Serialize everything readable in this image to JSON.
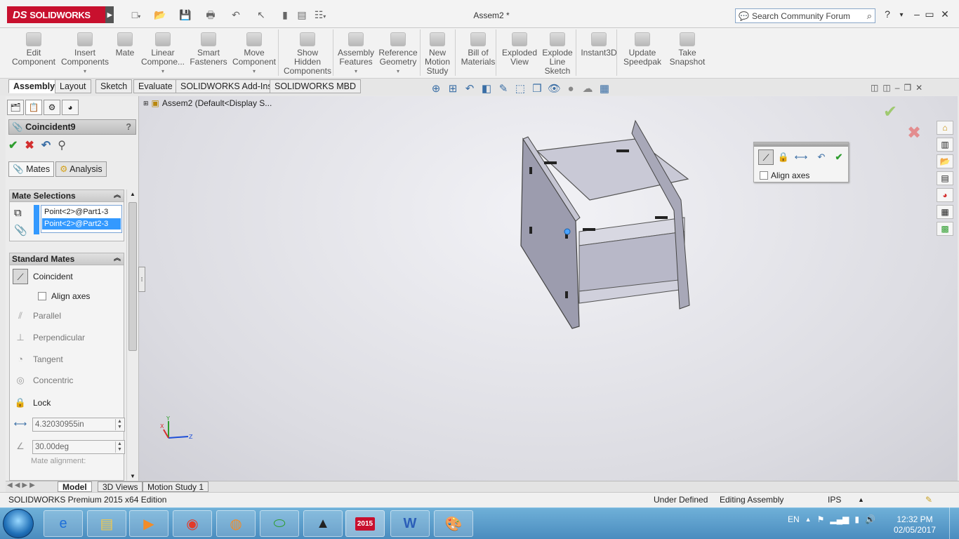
{
  "app": {
    "brand": "SOLIDWORKS",
    "doc_title": "Assem2 *",
    "search_placeholder": "Search Community Forum"
  },
  "ribbon": [
    {
      "label": "Edit\nComponent"
    },
    {
      "label": "Insert\nComponents"
    },
    {
      "label": "Mate"
    },
    {
      "label": "Linear\nCompone..."
    },
    {
      "label": "Smart\nFasteners"
    },
    {
      "label": "Move\nComponent"
    },
    {
      "label": "Show\nHidden\nComponents"
    },
    {
      "label": "Assembly\nFeatures"
    },
    {
      "label": "Reference\nGeometry"
    },
    {
      "label": "New\nMotion\nStudy"
    },
    {
      "label": "Bill of\nMaterials"
    },
    {
      "label": "Exploded\nView"
    },
    {
      "label": "Explode\nLine\nSketch"
    },
    {
      "label": "Instant3D"
    },
    {
      "label": "Update\nSpeedpak"
    },
    {
      "label": "Take\nSnapshot"
    }
  ],
  "command_tabs": [
    "Assembly",
    "Layout",
    "Sketch",
    "Evaluate",
    "SOLIDWORKS Add-Ins",
    "SOLIDWORKS MBD"
  ],
  "property_manager": {
    "title": "Coincident9",
    "help": "?",
    "tabs": [
      "Mates",
      "Analysis"
    ],
    "mate_selections": {
      "header": "Mate Selections",
      "items": [
        "Point<2>@Part1-3",
        "Point<2>@Part2-3"
      ]
    },
    "standard_mates": {
      "header": "Standard Mates",
      "coincident": "Coincident",
      "align_axes": "Align axes",
      "parallel": "Parallel",
      "perpendicular": "Perpendicular",
      "tangent": "Tangent",
      "concentric": "Concentric",
      "lock": "Lock",
      "distance": "4.32030955in",
      "angle": "30.00deg",
      "mate_alignment": "Mate alignment:"
    }
  },
  "feature_tree": {
    "root": "Assem2  (Default<Display S..."
  },
  "float_panel": {
    "align_axes": "Align axes"
  },
  "bottom_tabs": [
    "Model",
    "3D Views",
    "Motion Study 1"
  ],
  "status": {
    "edition": "SOLIDWORKS Premium 2015 x64 Edition",
    "state": "Under Defined",
    "mode": "Editing Assembly",
    "units": "IPS"
  },
  "taskbar": {
    "lang": "EN",
    "time": "12:32 PM",
    "date": "02/05/2017",
    "sw_badge": "2015"
  },
  "triad": {
    "x": "X",
    "y": "Y",
    "z": "Z"
  },
  "colors": {
    "brand_red": "#c8102e",
    "selection_blue": "#3399ff",
    "ok_green": "#2e9d2e",
    "cancel_red": "#d32f2f"
  }
}
